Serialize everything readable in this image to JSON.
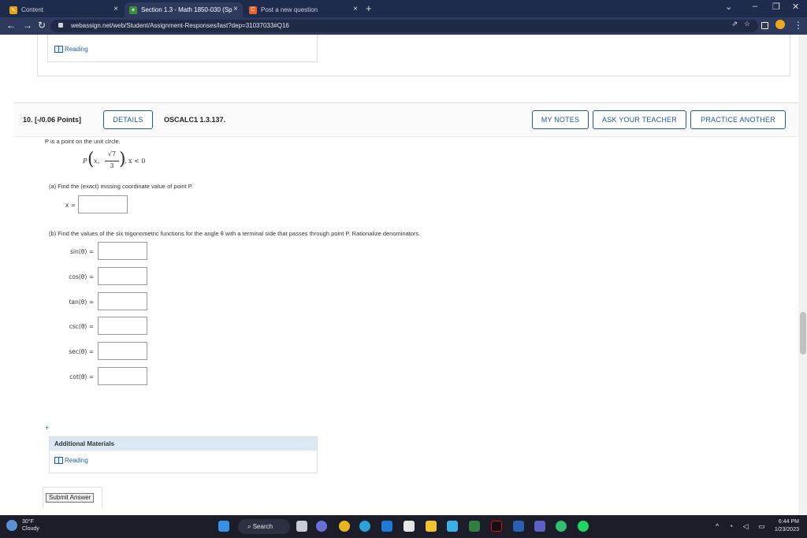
{
  "browser": {
    "tabs": [
      {
        "label": "Content",
        "active": false
      },
      {
        "label": "Section 1.3 - Math 1850-030 (Sp",
        "active": true
      },
      {
        "label": "Post a new question",
        "active": false
      }
    ],
    "url": "webassign.net/web/Student/Assignment-Responses/last?dep=31037033#Q16",
    "new_tab": "+",
    "tab_close": "×"
  },
  "prev_card": {
    "reading_label": "Reading"
  },
  "question": {
    "number": "10.",
    "points": "[-/0.06 Points]",
    "details_label": "DETAILS",
    "code": "OSCALC1 1.3.137.",
    "my_notes_label": "MY NOTES",
    "ask_teacher_label": "ASK YOUR TEACHER",
    "practice_label": "PRACTICE ANOTHER",
    "intro": "P is a point on the unit circle.",
    "point_prefix": "P",
    "point_x": "x,",
    "point_num": "√7",
    "point_den": "3",
    "point_cond": ", x < 0",
    "part_a": "(a)   Find the (exact) missing coordinate value of point P.",
    "x_label": "x =",
    "part_b": "(b)   Find the values of the six trigonometric functions for the angle θ with a terminal side that passes through point P. Rationalize denominators.",
    "functions": [
      {
        "label": "sin(θ)  ="
      },
      {
        "label": "cos(θ)  ="
      },
      {
        "label": "tan(θ)  ="
      },
      {
        "label": "csc(θ)  ="
      },
      {
        "label": "sec(θ)  ="
      },
      {
        "label": "cot(θ)  ="
      }
    ],
    "plus": "+",
    "additional_materials": "Additional Materials",
    "reading_label": "Reading",
    "submit_label": "Submit Answer"
  },
  "taskbar": {
    "temp": "30°F",
    "condition": "Cloudy",
    "search_label": "Search",
    "time": "6:44 PM",
    "date": "1/23/2023"
  }
}
